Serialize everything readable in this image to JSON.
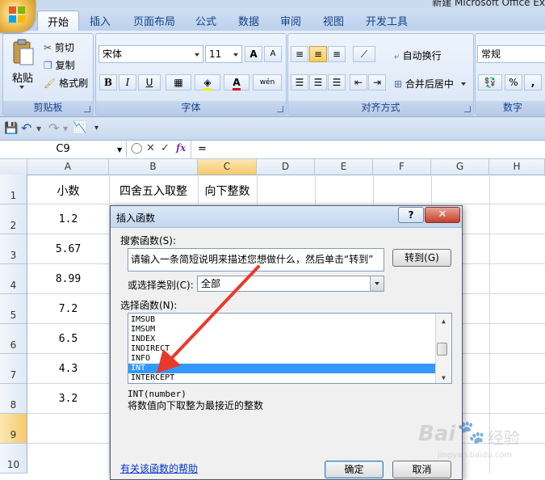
{
  "window": {
    "title": "新建 Microsoft Office Ex"
  },
  "tabs": [
    {
      "label": "开始"
    },
    {
      "label": "插入"
    },
    {
      "label": "页面布局"
    },
    {
      "label": "公式"
    },
    {
      "label": "数据"
    },
    {
      "label": "审阅"
    },
    {
      "label": "视图"
    },
    {
      "label": "开发工具"
    }
  ],
  "ribbon": {
    "clipboard": {
      "paste": "粘贴",
      "cut": "剪切",
      "copy": "复制",
      "format_painter": "格式刷",
      "label": "剪贴板"
    },
    "font": {
      "font_name": "宋体",
      "font_size": "11",
      "label": "字体",
      "bold": "B",
      "italic": "I",
      "underline": "U",
      "grow": "A",
      "shrink": "A",
      "font_color": "A",
      "phonetic": "wén"
    },
    "alignment": {
      "wrap": "自动换行",
      "merge": "合并后居中",
      "label": "对齐方式"
    },
    "number": {
      "format": "常规",
      "label": "数字",
      "percent": "%",
      "comma": ","
    }
  },
  "formula_bar": {
    "name_box": "C9",
    "formula": "=",
    "fx": "fx"
  },
  "columns": [
    "A",
    "B",
    "C",
    "D",
    "E",
    "F",
    "G",
    "H"
  ],
  "rows": [
    "1",
    "2",
    "3",
    "4",
    "5",
    "6",
    "7",
    "8",
    "9",
    "10"
  ],
  "cells": {
    "A1": "小数",
    "B1": "四舍五入取整",
    "C1": "向下整数",
    "A2": "1.2",
    "A3": "5.67",
    "A4": "8.99",
    "A5": "7.2",
    "A6": "6.5",
    "A7": "4.3",
    "A8": "3.2"
  },
  "dialog": {
    "title": "插入函数",
    "help_btn": "?",
    "search_label": "搜索函数(S):",
    "search_placeholder": "请输入一条简短说明来描述您想做什么，然后单击“转到”",
    "go_button": "转到(G)",
    "category_label": "或选择类别(C):",
    "category_value": "全部",
    "select_label": "选择函数(N):",
    "functions": [
      "IMSUB",
      "IMSUM",
      "INDEX",
      "INDIRECT",
      "INFO",
      "INT",
      "INTERCEPT"
    ],
    "selected_function": "INT",
    "signature": "INT(number)",
    "description": "将数值向下取整为最接近的整数",
    "help_link": "有关该函数的帮助",
    "ok": "确定",
    "cancel": "取消"
  },
  "watermark": {
    "brand": "Bai",
    "suffix": "经验",
    "sub": "jingyan.baidu.com"
  },
  "colors": {
    "accent": "#3399ff",
    "arrow": "#e8392a",
    "ribbon": "#d6e3f5"
  }
}
